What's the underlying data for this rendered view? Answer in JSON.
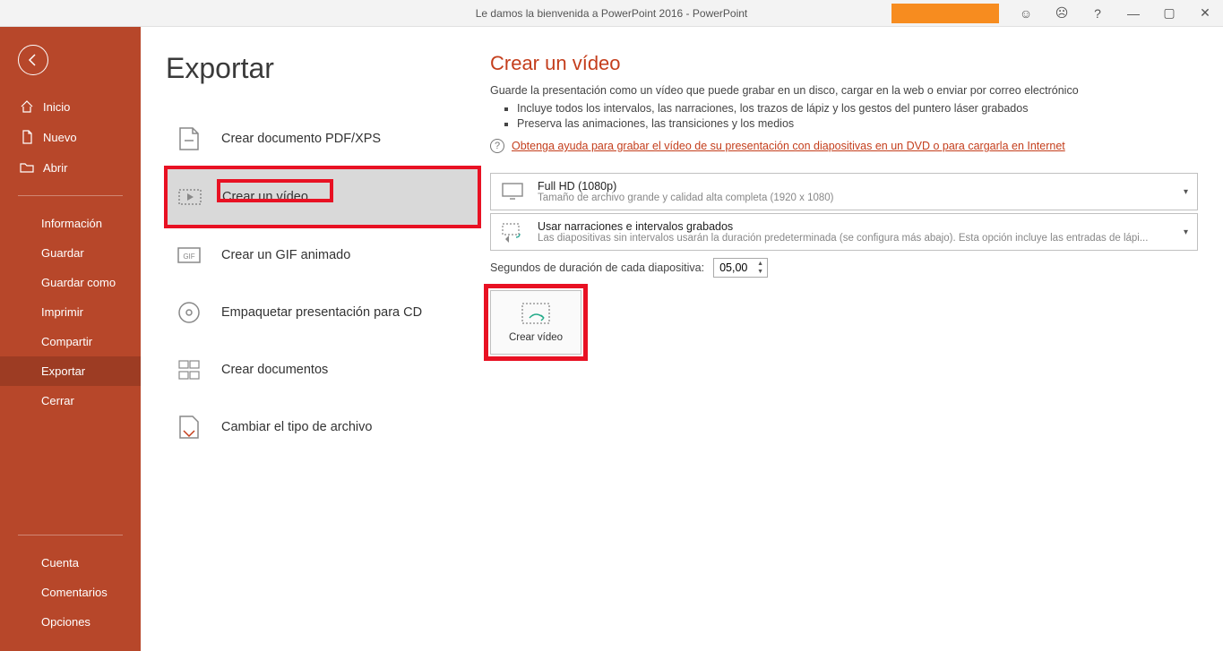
{
  "titlebar": {
    "title": "Le damos la bienvenida a PowerPoint 2016  -  PowerPoint"
  },
  "sidebar": {
    "top": [
      {
        "key": "inicio",
        "label": "Inicio"
      },
      {
        "key": "nuevo",
        "label": "Nuevo"
      },
      {
        "key": "abrir",
        "label": "Abrir"
      }
    ],
    "mid": [
      {
        "key": "informacion",
        "label": "Información"
      },
      {
        "key": "guardar",
        "label": "Guardar"
      },
      {
        "key": "guardar-como",
        "label": "Guardar como"
      },
      {
        "key": "imprimir",
        "label": "Imprimir"
      },
      {
        "key": "compartir",
        "label": "Compartir"
      },
      {
        "key": "exportar",
        "label": "Exportar",
        "selected": true
      },
      {
        "key": "cerrar",
        "label": "Cerrar"
      }
    ],
    "bottom": [
      {
        "key": "cuenta",
        "label": "Cuenta"
      },
      {
        "key": "comentarios",
        "label": "Comentarios"
      },
      {
        "key": "opciones",
        "label": "Opciones"
      }
    ]
  },
  "content": {
    "heading": "Exportar",
    "exports": [
      {
        "key": "pdf-xps",
        "label": "Crear documento PDF/XPS"
      },
      {
        "key": "video",
        "label": "Crear un vídeo",
        "selected": true
      },
      {
        "key": "gif",
        "label": "Crear un GIF animado"
      },
      {
        "key": "cd",
        "label": "Empaquetar presentación para CD"
      },
      {
        "key": "docs",
        "label": "Crear documentos"
      },
      {
        "key": "filetype",
        "label": "Cambiar el tipo de archivo"
      }
    ]
  },
  "detail": {
    "title": "Crear un vídeo",
    "desc": "Guarde la presentación como un vídeo que puede grabar en un disco, cargar en la web o enviar por correo electrónico",
    "bullets": [
      "Incluye todos los intervalos, las narraciones, los trazos de lápiz y los gestos del puntero láser grabados",
      "Preserva las animaciones, las transiciones y los medios"
    ],
    "help_link": "Obtenga ayuda para grabar el vídeo de su presentación con diapositivas en un DVD o para cargarla en Internet",
    "quality": {
      "main": "Full HD (1080p)",
      "sub": "Tamaño de archivo grande y calidad alta completa (1920 x 1080)"
    },
    "narration": {
      "main": "Usar narraciones e intervalos grabados",
      "sub": "Las diapositivas sin intervalos usarán la duración predeterminada (se configura más abajo). Esta opción incluye las entradas de lápi..."
    },
    "duration_label": "Segundos de duración de cada diapositiva:",
    "duration_value": "05,00",
    "create_button": "Crear vídeo"
  }
}
